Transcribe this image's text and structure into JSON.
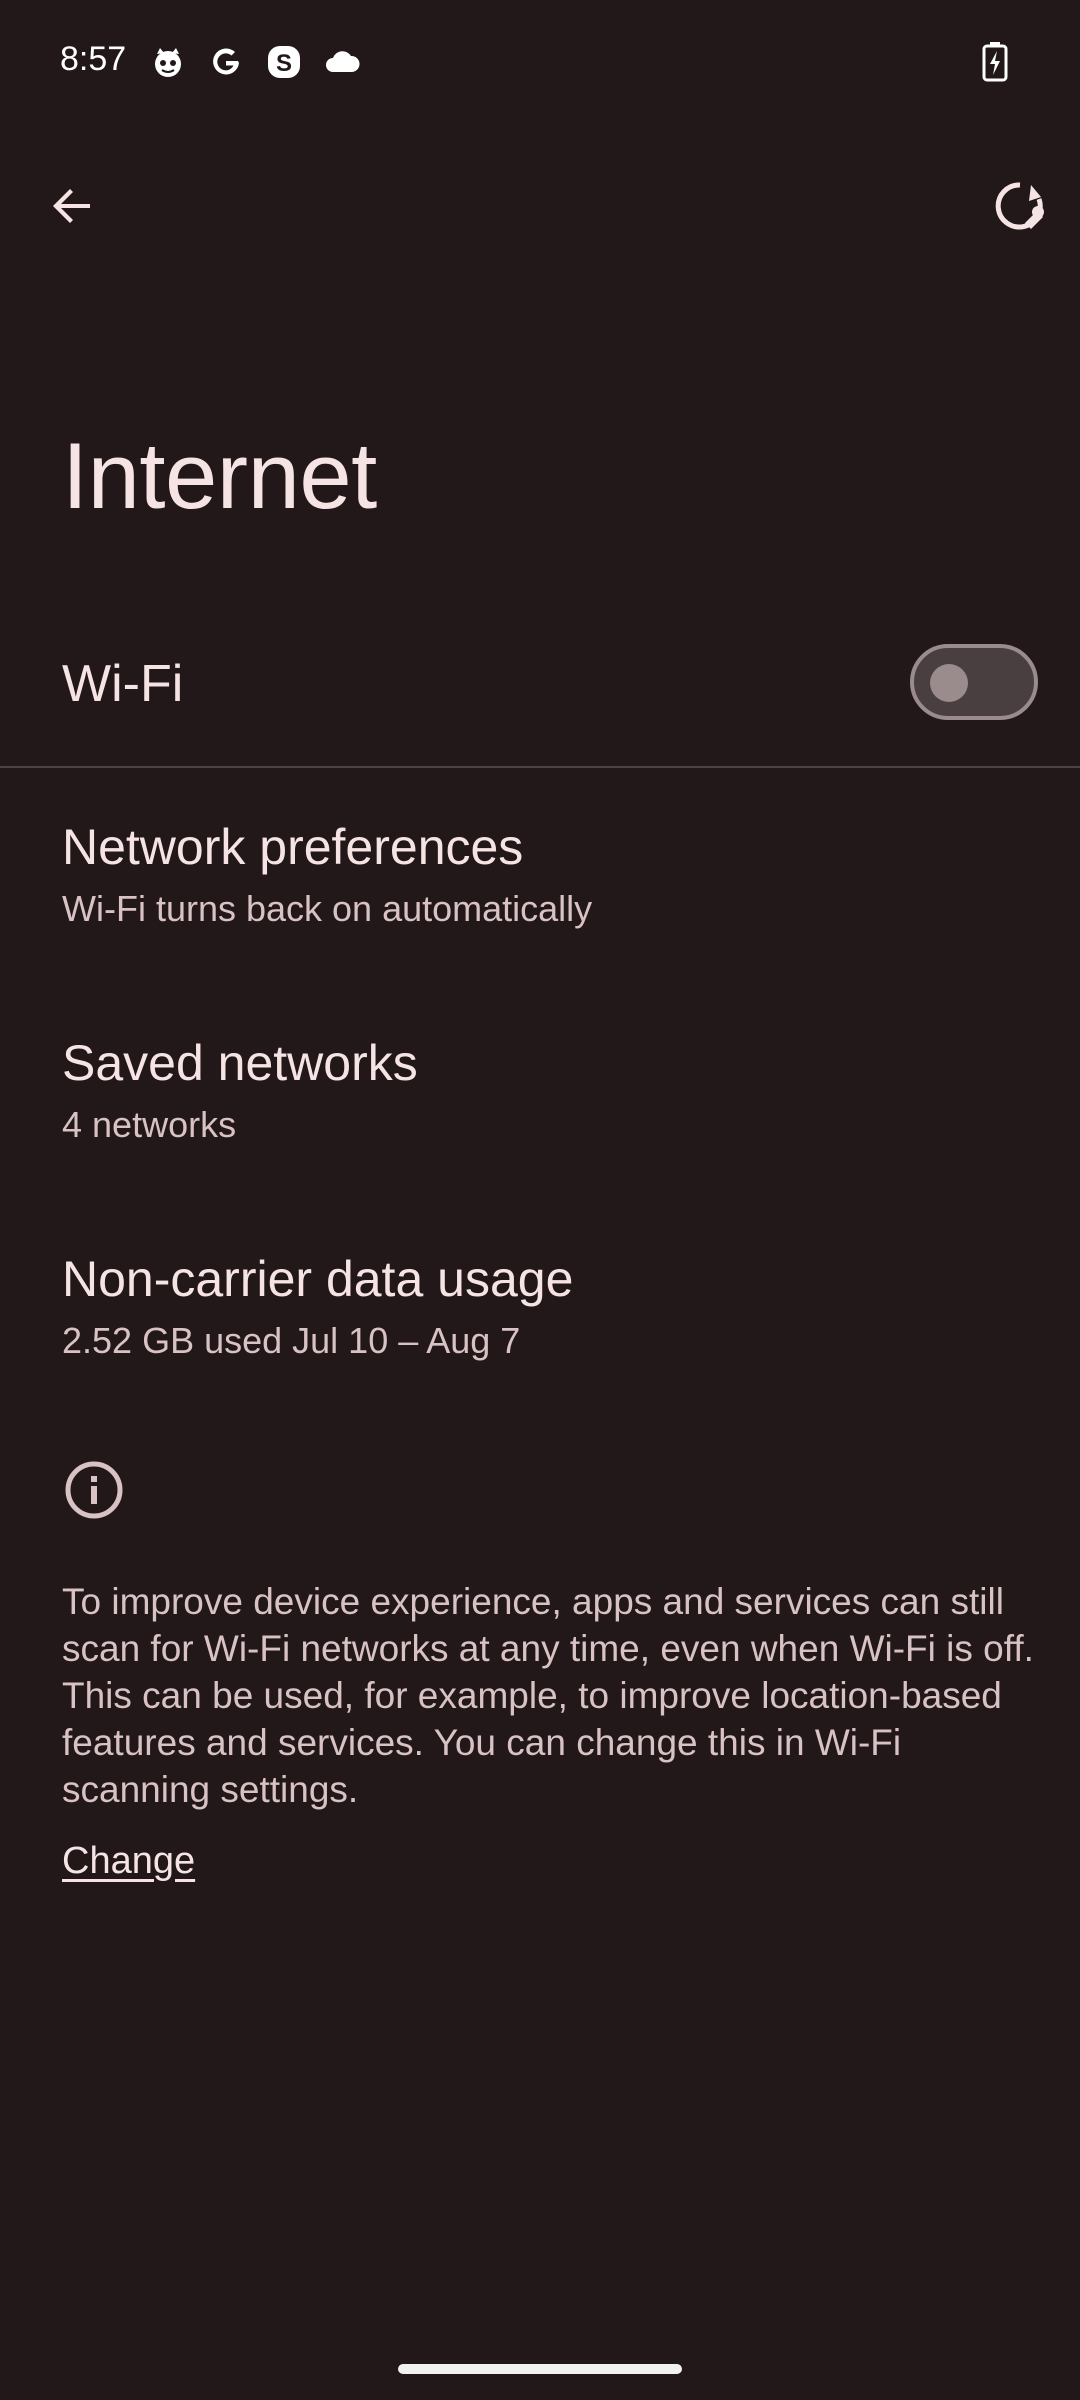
{
  "status_bar": {
    "time": "8:57",
    "icons": [
      "cat-face-icon",
      "google-icon",
      "skype-icon",
      "cloud-icon"
    ],
    "battery_icon": "battery-charging-icon"
  },
  "app_bar": {
    "back_icon": "arrow-back-icon",
    "help_icon": "help-refresh-icon"
  },
  "page": {
    "title": "Internet"
  },
  "wifi": {
    "label": "Wi-Fi",
    "enabled": false
  },
  "list": [
    {
      "title": "Network preferences",
      "subtitle": "Wi-Fi turns back on automatically"
    },
    {
      "title": "Saved networks",
      "subtitle": "4 networks"
    },
    {
      "title": "Non-carrier data usage",
      "subtitle": "2.52 GB used Jul 10 – Aug 7"
    }
  ],
  "info": {
    "icon": "info-icon",
    "text": "To improve device experience, apps and services can still scan for Wi-Fi networks at any time, even when Wi-Fi is off. This can be used, for example, to improve location-based features and services. You can change this in Wi-Fi scanning settings.",
    "link_label": "Change"
  },
  "colors": {
    "background": "#221819",
    "text_primary": "#f6e4e4",
    "text_secondary": "#d8c2c3",
    "toggle_off_track": "#4a3f40",
    "toggle_off_outline": "#9a8b8c"
  }
}
